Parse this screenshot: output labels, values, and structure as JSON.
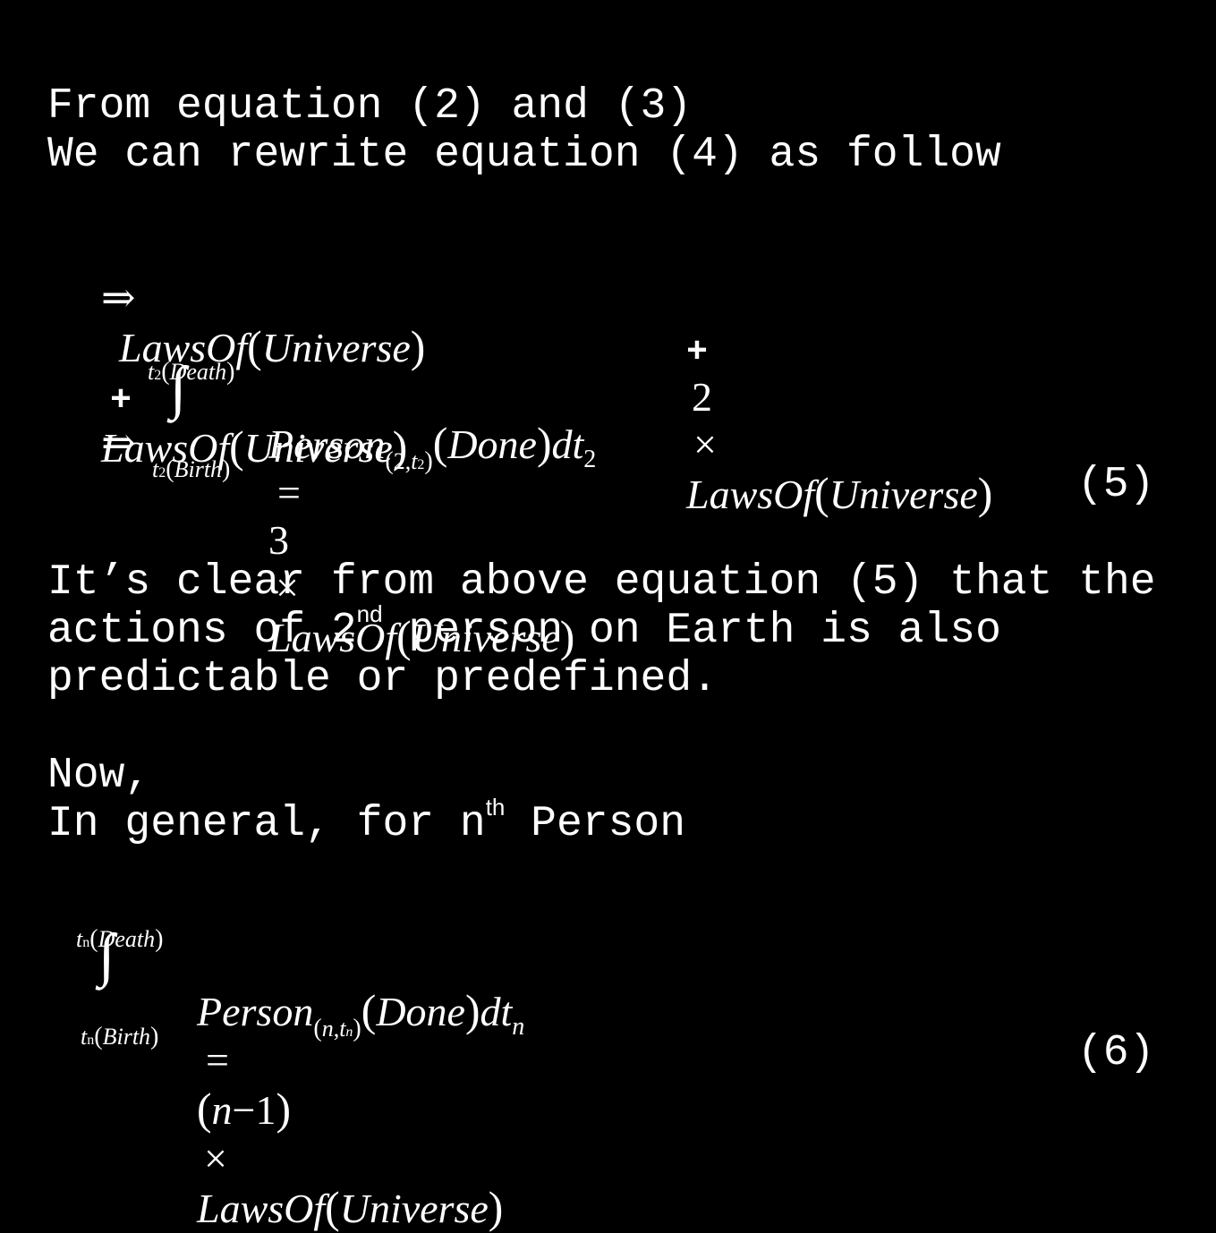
{
  "intro": {
    "line1": "From equation (2) and (3)",
    "line2": "We can rewrite equation (4) as follow"
  },
  "eq_a": {
    "implies": "⇒",
    "term1": "LawsOf",
    "arg1": "Universe",
    "plus1": "+",
    "term2": "LawsOf",
    "arg2": "Universe",
    "plus2": "+",
    "coef": "2",
    "times": "×",
    "term3": "LawsOf",
    "arg3": "Universe"
  },
  "eq_5": {
    "implies": "⇒",
    "upper_t": "t",
    "upper_sub": "2",
    "upper_arg": "Death",
    "integral": "∫",
    "lower_t": "t",
    "lower_sub": "2",
    "lower_arg": "Birth",
    "person": "Person",
    "person_sub_a": "2",
    "person_sub_t": "t",
    "person_sub_tsub": "2",
    "done": "Done",
    "dt": "dt",
    "dt_sub": "2",
    "equals": "=",
    "coef": "3",
    "times": "×",
    "laws": "LawsOf",
    "universe": "Universe",
    "number": "(5)"
  },
  "para1": {
    "line1": "It’s clear from above equation (5) that the",
    "line2_a": "actions of 2",
    "line2_sup": "nd",
    "line2_b": " person on Earth is also",
    "line3": "predictable or predefined."
  },
  "para2": {
    "line1": "Now,",
    "line2_a": "In general, for n",
    "line2_sup": "th",
    "line2_b": " Person"
  },
  "eq_6": {
    "upper_t": "t",
    "upper_sub": "n",
    "upper_arg": "Death",
    "integral": "∫",
    "lower_t": "t",
    "lower_sub": "n",
    "lower_arg": "Birth",
    "person": "Person",
    "person_sub_a": "n",
    "person_sub_t": "t",
    "person_sub_tsub": "n",
    "done": "Done",
    "dt": "dt",
    "dt_sub": "n",
    "equals": "=",
    "coef_n": "n",
    "coef_minus": "−",
    "coef_one": "1",
    "times": "×",
    "laws": "LawsOf",
    "universe": "Universe",
    "number": "(6)"
  }
}
